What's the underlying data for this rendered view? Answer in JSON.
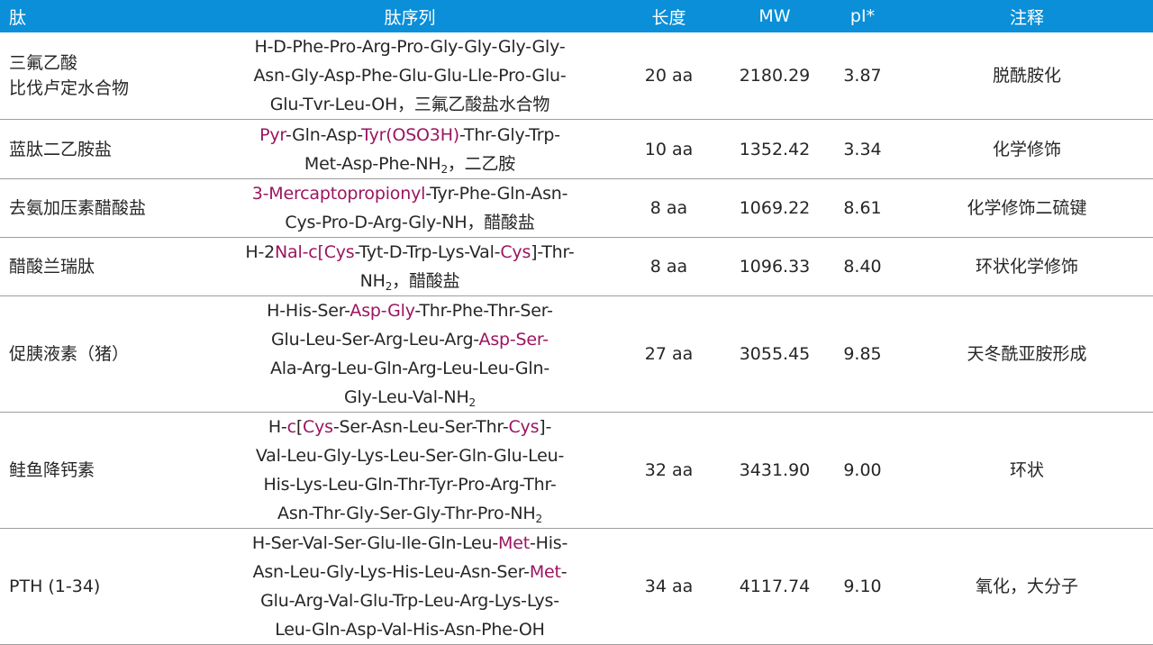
{
  "header": {
    "col_name": "肽",
    "col_seq": "肽序列",
    "col_len": "长度",
    "col_mw": "MW",
    "col_pi": "pI*",
    "col_note": "注释"
  },
  "rows": [
    {
      "name_line1": "三氟乙酸",
      "name_line2": "比伐卢定水合物",
      "seq": [
        [
          {
            "t": "H-D-Phe-Pro-Arg-Pro-Gly-Gly-Gly-Gly-"
          }
        ],
        [
          {
            "t": "Asn-Gly-Asp-Phe-Glu-Glu-Lle-Pro-Glu-"
          }
        ],
        [
          {
            "t": "Glu-Tvr-Leu-OH，三氟乙酸盐水合物"
          }
        ]
      ],
      "length": "20 aa",
      "mw": "2180.29",
      "pi": "3.87",
      "note": "脱酰胺化"
    },
    {
      "name_line1": "蓝肽二乙胺盐",
      "seq": [
        [
          {
            "t": "Pyr",
            "hl": true
          },
          {
            "t": "-Gln-Asp-"
          },
          {
            "t": "Tyr(OSO3H)",
            "hl": true
          },
          {
            "t": "-Thr-Gly-Trp-"
          }
        ],
        [
          {
            "t": "Met-Asp-Phe-NH"
          },
          {
            "t": "2",
            "sub": true
          },
          {
            "t": "，二乙胺"
          }
        ]
      ],
      "length": "10 aa",
      "mw": "1352.42",
      "pi": "3.34",
      "note": "化学修饰"
    },
    {
      "name_line1": "去氨加压素醋酸盐",
      "seq": [
        [
          {
            "t": "3-Mercaptopropionyl",
            "hl": true
          },
          {
            "t": "-Tyr-Phe-Gln-Asn-"
          }
        ],
        [
          {
            "t": "Cys-Pro-D-Arg-Gly-NH，醋酸盐"
          }
        ]
      ],
      "length": "8 aa",
      "mw": "1069.22",
      "pi": "8.61",
      "note": "化学修饰二硫键"
    },
    {
      "name_line1": "醋酸兰瑞肽",
      "seq": [
        [
          {
            "t": "H-2"
          },
          {
            "t": "Nal-c[Cys",
            "hl": true
          },
          {
            "t": "-Tyt-D-Trp-Lys-Val-"
          },
          {
            "t": "Cys",
            "hl": true
          },
          {
            "t": "]-Thr-"
          }
        ],
        [
          {
            "t": "NH"
          },
          {
            "t": "2",
            "sub": true
          },
          {
            "t": "，醋酸盐"
          }
        ]
      ],
      "length": "8 aa",
      "mw": "1096.33",
      "pi": "8.40",
      "note": "环状化学修饰"
    },
    {
      "name_line1": "促胰液素（猪）",
      "seq": [
        [
          {
            "t": "H-His-Ser-"
          },
          {
            "t": "Asp-Gly",
            "hl": true
          },
          {
            "t": "-Thr-Phe-Thr-Ser-"
          }
        ],
        [
          {
            "t": "Glu-Leu-Ser-Arg-Leu-Arg-"
          },
          {
            "t": "Asp-Ser-",
            "hl": true
          }
        ],
        [
          {
            "t": "Ala-Arg-Leu-Gln-Arg-Leu-Leu-Gln-"
          }
        ],
        [
          {
            "t": "Gly-Leu-Val-NH"
          },
          {
            "t": "2",
            "sub": true
          }
        ]
      ],
      "length": "27 aa",
      "mw": "3055.45",
      "pi": "9.85",
      "note": "天冬酰亚胺形成"
    },
    {
      "name_line1": "鲑鱼降钙素",
      "seq": [
        [
          {
            "t": "H-"
          },
          {
            "t": "c",
            "hl": true
          },
          {
            "t": "["
          },
          {
            "t": "Cys",
            "hl": true
          },
          {
            "t": "-Ser-Asn-Leu-Ser-Thr-"
          },
          {
            "t": "Cys",
            "hl": true
          },
          {
            "t": "]-"
          }
        ],
        [
          {
            "t": "Val-Leu-Gly-Lys-Leu-Ser-Gln-Glu-Leu-"
          }
        ],
        [
          {
            "t": "His-Lys-Leu-Gln-Thr-Tyr-Pro-Arg-Thr-"
          }
        ],
        [
          {
            "t": "Asn-Thr-Gly-Ser-Gly-Thr-Pro-NH"
          },
          {
            "t": "2",
            "sub": true
          }
        ]
      ],
      "length": "32 aa",
      "mw": "3431.90",
      "pi": "9.00",
      "note": "环状"
    },
    {
      "name_line1": "PTH (1-34)",
      "seq": [
        [
          {
            "t": "H-Ser-Val-Ser-Glu-Ile-Gln-Leu-"
          },
          {
            "t": "Met",
            "hl": true
          },
          {
            "t": "-His-"
          }
        ],
        [
          {
            "t": "Asn-Leu-Gly-Lys-His-Leu-Asn-Ser-"
          },
          {
            "t": "Met",
            "hl": true
          },
          {
            "t": "-"
          }
        ],
        [
          {
            "t": "Glu-Arg-Val-Glu-Trp-Leu-Arg-Lys-Lys-"
          }
        ],
        [
          {
            "t": "Leu-Gln-Asp-Val-His-Asn-Phe-OH"
          }
        ]
      ],
      "length": "34 aa",
      "mw": "4117.74",
      "pi": "9.10",
      "note": "氧化，大分子"
    }
  ]
}
